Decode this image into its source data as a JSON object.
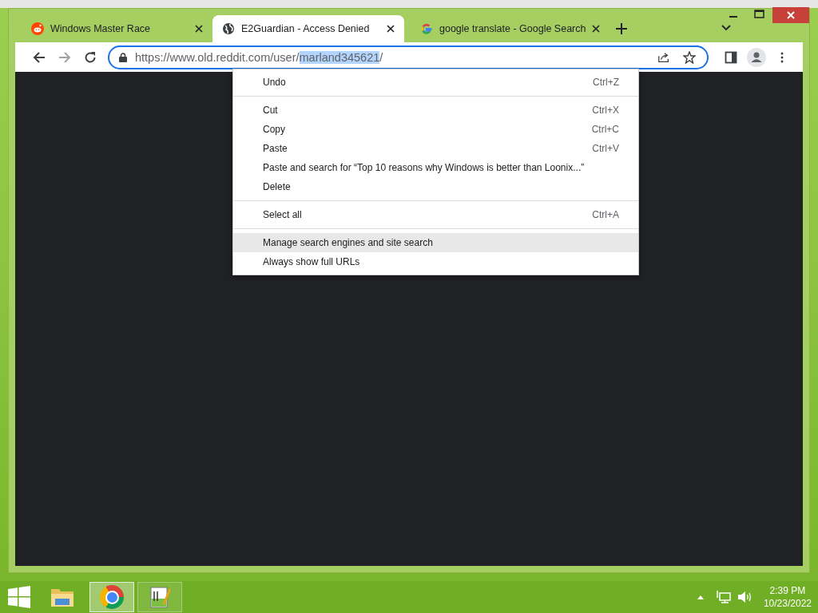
{
  "browser": {
    "tabs": [
      {
        "title": "Windows Master Race",
        "selected": false
      },
      {
        "title": "E2Guardian - Access Denied",
        "selected": true
      },
      {
        "title": "google translate - Google Search",
        "selected": false
      }
    ],
    "address_bar": {
      "url_start": "https://www.old.reddit.com/user/",
      "url_selected": "marland345621",
      "url_end": "/"
    }
  },
  "context_menu": {
    "items": [
      {
        "kind": "item",
        "label": "Undo",
        "shortcut": "Ctrl+Z",
        "highlighted": false
      },
      {
        "kind": "separator"
      },
      {
        "kind": "item",
        "label": "Cut",
        "shortcut": "Ctrl+X",
        "highlighted": false
      },
      {
        "kind": "item",
        "label": "Copy",
        "shortcut": "Ctrl+C",
        "highlighted": false
      },
      {
        "kind": "item",
        "label": "Paste",
        "shortcut": "Ctrl+V",
        "highlighted": false
      },
      {
        "kind": "item",
        "label": "Paste and search for “Top 10 reasons why Windows is better than Loonix...”",
        "highlighted": false
      },
      {
        "kind": "item",
        "label": "Delete",
        "highlighted": false
      },
      {
        "kind": "separator"
      },
      {
        "kind": "item",
        "label": "Select all",
        "shortcut": "Ctrl+A",
        "highlighted": false
      },
      {
        "kind": "separator"
      },
      {
        "kind": "item",
        "label": "Manage search engines and site search",
        "highlighted": true
      },
      {
        "kind": "item",
        "label": "Always show full URLs",
        "highlighted": false
      }
    ]
  },
  "taskbar": {
    "apps": [
      {
        "selected": false
      },
      {
        "selected": true
      },
      {
        "selected": false
      }
    ],
    "clock": {
      "time": "2:39 PM",
      "date": "10/23/2022"
    }
  }
}
